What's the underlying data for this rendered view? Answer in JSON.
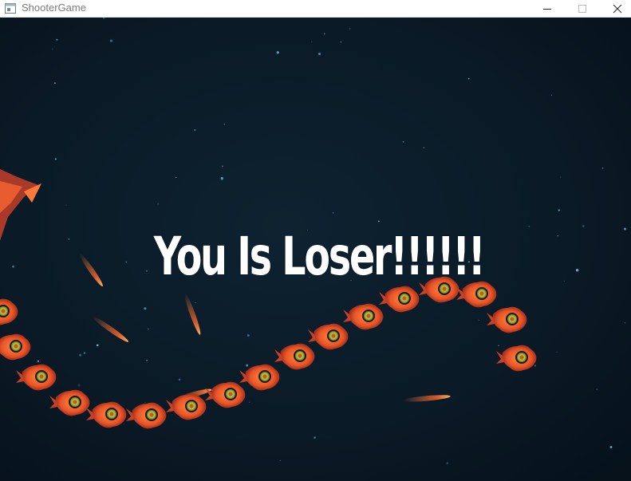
{
  "window": {
    "title": "ShooterGame",
    "controls": [
      "minimize",
      "maximize",
      "close"
    ]
  },
  "game": {
    "message": "You Is Loser!!!!!!",
    "background_color": "#0b1c28",
    "enemy_color": "#e8552a",
    "enemy_core_color": "#8fbf3a",
    "bullet_color": "#ff7a3a"
  }
}
